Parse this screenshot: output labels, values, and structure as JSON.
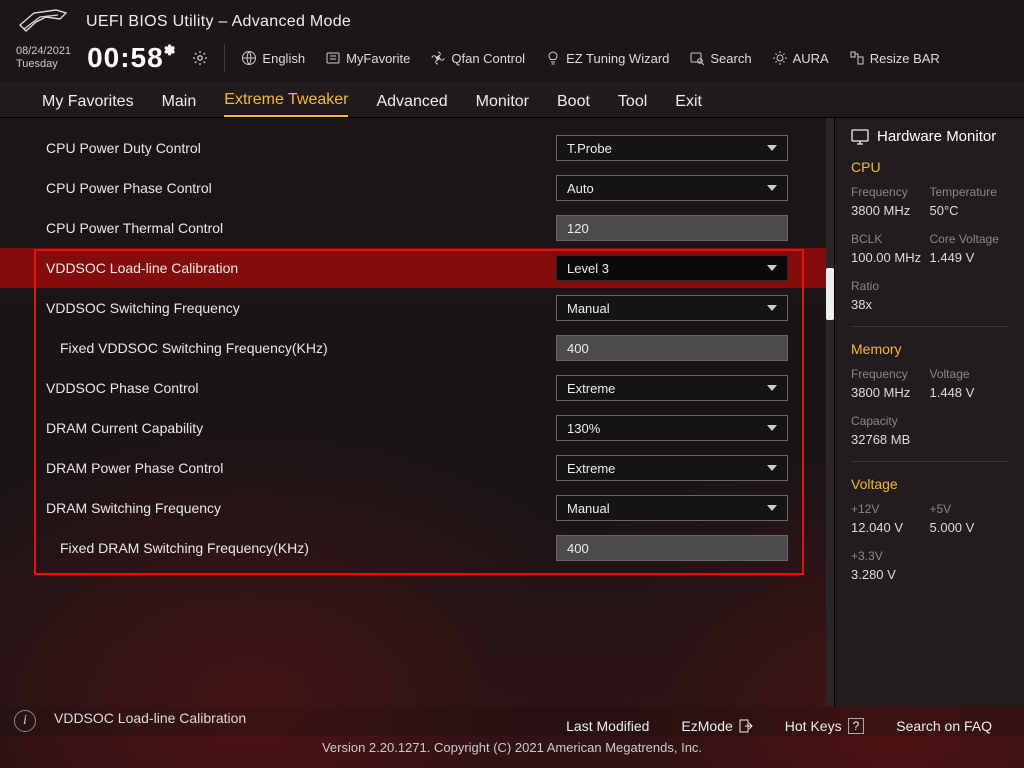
{
  "header": {
    "title": "UEFI BIOS Utility – Advanced Mode"
  },
  "datetime": {
    "date": "08/24/2021",
    "day": "Tuesday",
    "time": "00:58"
  },
  "toolbar": {
    "lang": "English",
    "fav": "MyFavorite",
    "qfan": "Qfan Control",
    "ez": "EZ Tuning Wizard",
    "search": "Search",
    "aura": "AURA",
    "resize": "Resize BAR"
  },
  "tabs": [
    "My Favorites",
    "Main",
    "Extreme Tweaker",
    "Advanced",
    "Monitor",
    "Boot",
    "Tool",
    "Exit"
  ],
  "active_tab": "Extreme Tweaker",
  "rows": [
    {
      "label": "CPU Power Duty Control",
      "type": "sel",
      "val": "T.Probe"
    },
    {
      "label": "CPU Power Phase Control",
      "type": "sel",
      "val": "Auto"
    },
    {
      "label": "CPU Power Thermal Control",
      "type": "txt",
      "val": "120"
    },
    {
      "label": "VDDSOC Load-line Calibration",
      "type": "sel",
      "val": "Level 3",
      "hl": true
    },
    {
      "label": "VDDSOC Switching Frequency",
      "type": "sel",
      "val": "Manual"
    },
    {
      "label": "Fixed VDDSOC Switching Frequency(KHz)",
      "type": "txt",
      "val": "400",
      "indent": true
    },
    {
      "label": "VDDSOC Phase Control",
      "type": "sel",
      "val": "Extreme"
    },
    {
      "label": "DRAM Current Capability",
      "type": "sel",
      "val": "130%"
    },
    {
      "label": "DRAM Power Phase Control",
      "type": "sel",
      "val": "Extreme"
    },
    {
      "label": "DRAM Switching Frequency",
      "type": "sel",
      "val": "Manual"
    },
    {
      "label": "Fixed DRAM Switching Frequency(KHz)",
      "type": "txt",
      "val": "400",
      "indent": true
    }
  ],
  "help_line": "VDDSOC Load-line Calibration",
  "hw": {
    "title": "Hardware Monitor",
    "cpu": {
      "label": "CPU",
      "freq_k": "Frequency",
      "freq_v": "3800 MHz",
      "temp_k": "Temperature",
      "temp_v": "50°C",
      "bclk_k": "BCLK",
      "bclk_v": "100.00 MHz",
      "cv_k": "Core Voltage",
      "cv_v": "1.449 V",
      "ratio_k": "Ratio",
      "ratio_v": "38x"
    },
    "mem": {
      "label": "Memory",
      "freq_k": "Frequency",
      "freq_v": "3800 MHz",
      "volt_k": "Voltage",
      "volt_v": "1.448 V",
      "cap_k": "Capacity",
      "cap_v": "32768 MB"
    },
    "volt": {
      "label": "Voltage",
      "v12_k": "+12V",
      "v12_v": "12.040 V",
      "v5_k": "+5V",
      "v5_v": "5.000 V",
      "v33_k": "+3.3V",
      "v33_v": "3.280 V"
    }
  },
  "footer": {
    "last": "Last Modified",
    "ez": "EzMode",
    "hot": "Hot Keys",
    "faq": "Search on FAQ",
    "hotkey": "?",
    "copy": "Version 2.20.1271. Copyright (C) 2021 American Megatrends, Inc."
  }
}
